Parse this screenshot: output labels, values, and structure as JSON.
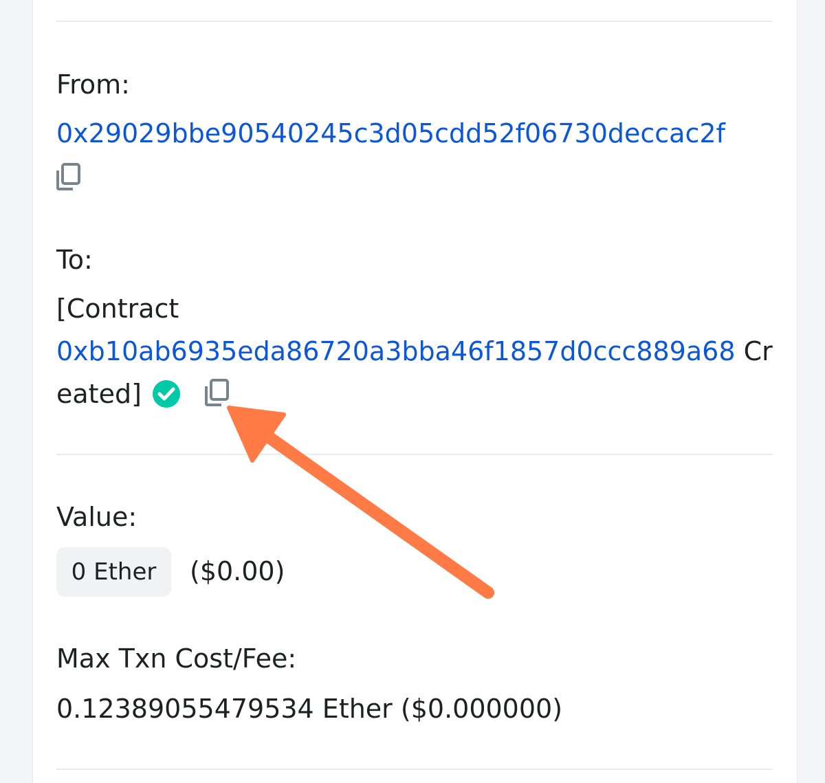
{
  "from": {
    "label": "From:",
    "address": "0x29029bbe90540245c3d05cdd52f06730deccac2f",
    "copy_icon": "copy-icon"
  },
  "to": {
    "label": "To:",
    "prefix": "[Contract",
    "address": "0xb10ab6935eda86720a3bba46f1857d0ccc889a68",
    "suffix_part1": " Cr",
    "suffix_part2": "eated]",
    "verified_icon": "check-circle-icon",
    "copy_icon": "copy-icon"
  },
  "value": {
    "label": "Value:",
    "amount": "0 Ether",
    "usd": "($0.00)"
  },
  "fee": {
    "label": "Max Txn Cost/Fee:",
    "amount": "0.12389055479534 Ether ($0.000000)"
  },
  "colors": {
    "link": "#0b56d9",
    "check": "#00c9a7",
    "annotation_arrow": "#ff7a45",
    "icon_gray": "#77838f"
  }
}
